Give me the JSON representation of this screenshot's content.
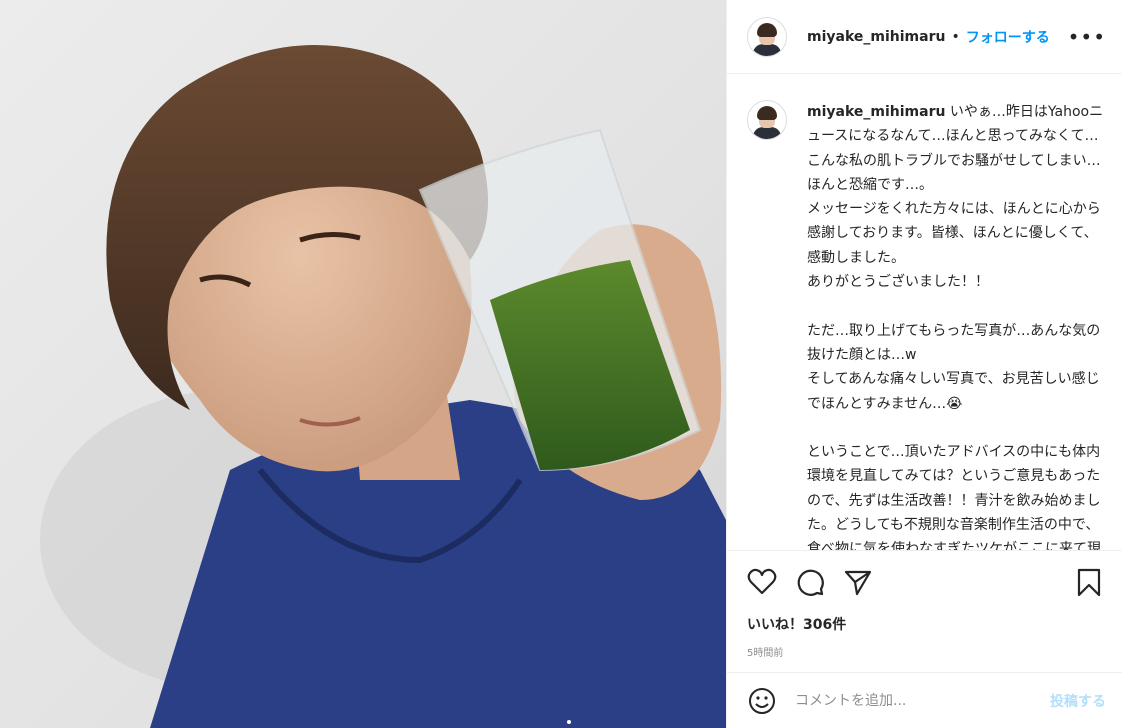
{
  "post": {
    "username": "miyake_mihimaru",
    "separator": "•",
    "follow_label": "フォローする",
    "more_label": "•••",
    "caption_username": "miyake_mihimaru",
    "caption_text": " いやぁ…昨日はYahooニュースになるなんて…ほんと思ってみなくて…こんな私の肌トラブルでお騒がせしてしまい…ほんと恐縮です…。\nメッセージをくれた方々には、ほんとに心から感謝しております。皆様、ほんとに優しくて、感動しました。\nありがとうございました！！\n\nただ…取り上げてもらった写真が…あんな気の抜けた顔とは…w\nそしてあんな痛々しい写真で、お見苦しい感じでほんとすみません…😭\n\nということで…頂いたアドバイスの中にも体内環境を見直してみては？というご意見もあったので、先ずは生活改善！！青汁を飲み始めました。どうしても不規則な音楽制作生活の中で、食べ物に気を使わなすぎたツケがここに来て現れたん",
    "likes": "いいね！306件",
    "time": "5時間前",
    "comment_placeholder": "コメントを追加...",
    "post_label": "投稿する"
  },
  "icons": [
    "heart-icon",
    "comment-icon",
    "share-icon",
    "bookmark-icon",
    "emoji-icon",
    "more-icon"
  ],
  "colors": {
    "accent": "#0095f6",
    "post_disabled": "#b2dffc",
    "muted": "#8e8e8e",
    "text": "#262626"
  }
}
